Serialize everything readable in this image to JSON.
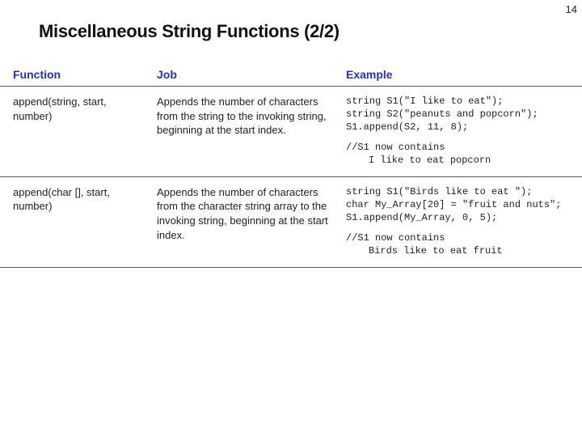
{
  "page_number": "14",
  "title": "Miscellaneous String Functions (2/2)",
  "headers": {
    "function": "Function",
    "job": "Job",
    "example": "Example"
  },
  "rows": [
    {
      "function": "append(string, start, number)",
      "job": "Appends the number of characters from the string to the invoking string, beginning at the start index.",
      "code_lines": [
        "string S1(\"I like to eat\");",
        "string S2(\"peanuts and popcorn\");",
        "S1.append(S2, 11, 8);"
      ],
      "comment": "//S1 now contains",
      "result": "I like to eat popcorn"
    },
    {
      "function": "append(char [], start, number)",
      "job": "Appends the number of characters from the character string array to the invoking string, beginning at the start index.",
      "code_lines": [
        "string S1(\"Birds like to eat \");",
        "char My_Array[20] = \"fruit and nuts\";",
        "S1.append(My_Array, 0, 5);"
      ],
      "comment": "//S1 now contains",
      "result": "Birds like to eat fruit"
    }
  ]
}
